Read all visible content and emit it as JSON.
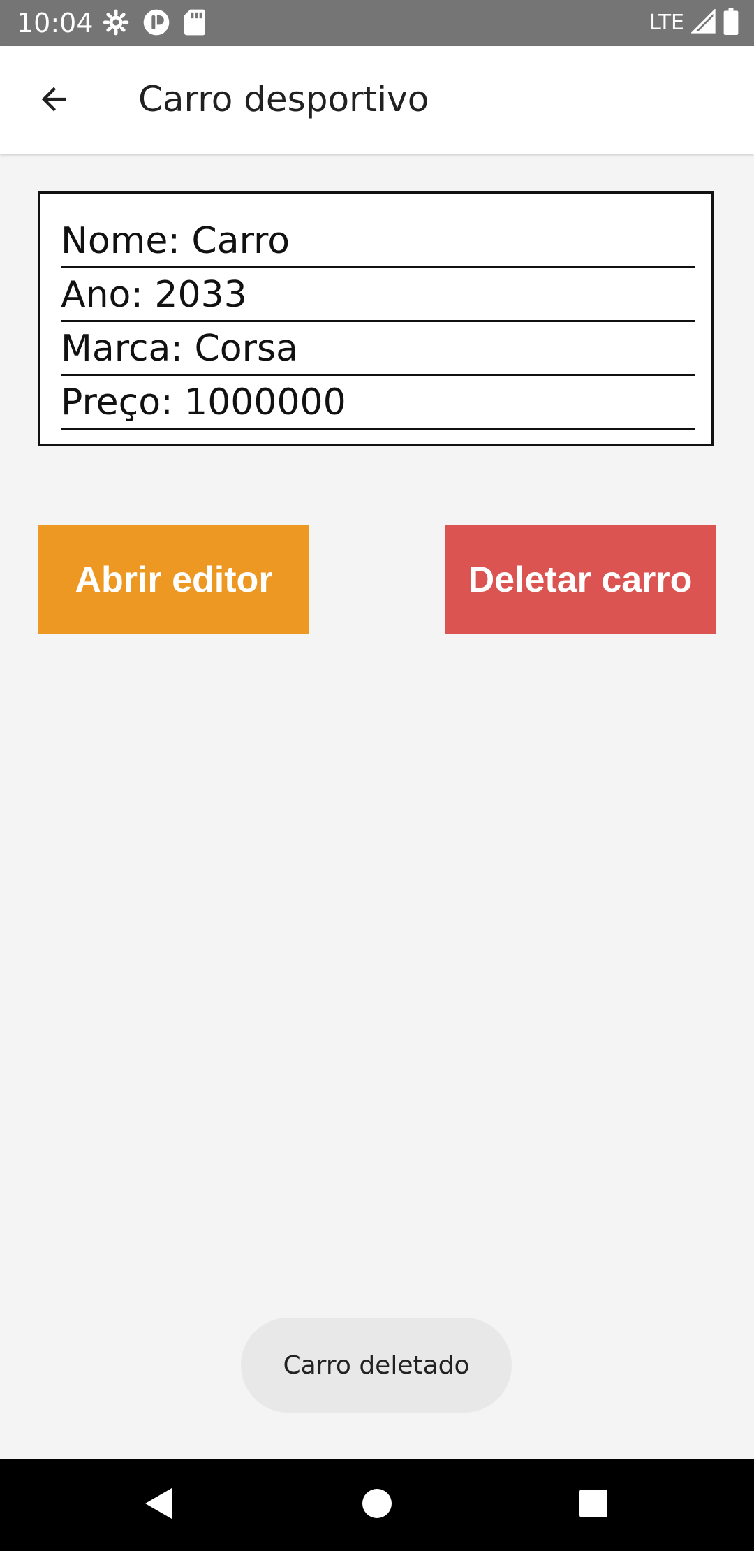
{
  "status_bar": {
    "time": "10:04",
    "network": "LTE",
    "icons": [
      "settings-gear-icon",
      "shield-app-icon",
      "sd-card-icon",
      "signal-icon",
      "battery-icon"
    ]
  },
  "app_bar": {
    "title": "Carro desportivo",
    "back_icon": "arrow-left-icon"
  },
  "car_details": {
    "nome": "Nome: Carro",
    "ano": "Ano: 2033",
    "marca": "Marca: Corsa",
    "preco": "Preço: 1000000"
  },
  "buttons": {
    "edit_label": "Abrir editor",
    "edit_color": "#ec9822",
    "delete_label": "Deletar carro",
    "delete_color": "#db5452"
  },
  "toast": {
    "message": "Carro deletado"
  },
  "nav_bar": {
    "icons": [
      "back-triangle-icon",
      "home-circle-icon",
      "recents-square-icon"
    ]
  }
}
